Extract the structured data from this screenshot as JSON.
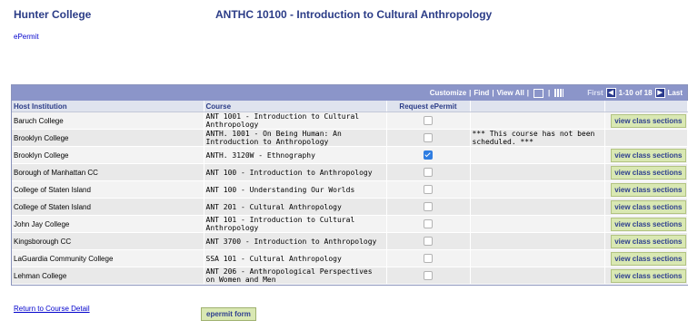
{
  "header": {
    "institution": "Hunter College",
    "course_title": "ANTHC 10100 - Introduction to Cultural Anthropology",
    "epermit_link": "ePermit"
  },
  "toolbar": {
    "customize": "Customize",
    "find": "Find",
    "view_all": "View All",
    "first": "First",
    "range": "1-10 of 18",
    "last": "Last"
  },
  "table": {
    "columns": [
      "Host Institution",
      "Course",
      "Request ePermit",
      "",
      ""
    ],
    "rows": [
      {
        "institution": "Baruch College",
        "course": "ANT 1001 - Introduction to Cultural Anthropology",
        "checked": false,
        "note": "",
        "action": "view class sections"
      },
      {
        "institution": "Brooklyn College",
        "course": "ANTH. 1001 - On Being Human: An Introduction to Anthropology",
        "checked": false,
        "note": "***  This course has not been scheduled.  ***",
        "action": ""
      },
      {
        "institution": "Brooklyn College",
        "course": "ANTH. 3120W - Ethnography",
        "checked": true,
        "note": "",
        "action": "view class sections"
      },
      {
        "institution": "Borough of Manhattan CC",
        "course": "ANT  100 - Introduction to Anthropology",
        "checked": false,
        "note": "",
        "action": "view class sections"
      },
      {
        "institution": "College of Staten Island",
        "course": "ANT  100 - Understanding Our Worlds",
        "checked": false,
        "note": "",
        "action": "view class sections"
      },
      {
        "institution": "College of Staten Island",
        "course": "ANT  201 - Cultural Anthropology",
        "checked": false,
        "note": "",
        "action": "view class sections"
      },
      {
        "institution": "John Jay College",
        "course": "ANT  101 - Introduction to Cultural Anthropology",
        "checked": false,
        "note": "",
        "action": "view class sections"
      },
      {
        "institution": "Kingsborough CC",
        "course": "ANT 3700 - Introduction to Anthropology",
        "checked": false,
        "note": "",
        "action": "view class sections"
      },
      {
        "institution": "LaGuardia Community College",
        "course": "SSA  101 - Cultural Anthropology",
        "checked": false,
        "note": "",
        "action": "view class sections"
      },
      {
        "institution": "Lehman College",
        "course": "ANT  206 - Anthropological Perspectives on Women and Men",
        "checked": false,
        "note": "",
        "action": "view class sections"
      }
    ]
  },
  "footer": {
    "return_link": "Return to Course Detail",
    "epermit_button": "epermit form"
  },
  "colors": {
    "title_blue": "#2b3c87",
    "toolbar_bg": "#8b95c9",
    "button_green": "#d9e8b3",
    "checked_blue": "#2f7de1"
  },
  "icons": [
    "zoom-grid-icon",
    "download-icon",
    "first-arrow-icon",
    "next-arrow-icon"
  ]
}
